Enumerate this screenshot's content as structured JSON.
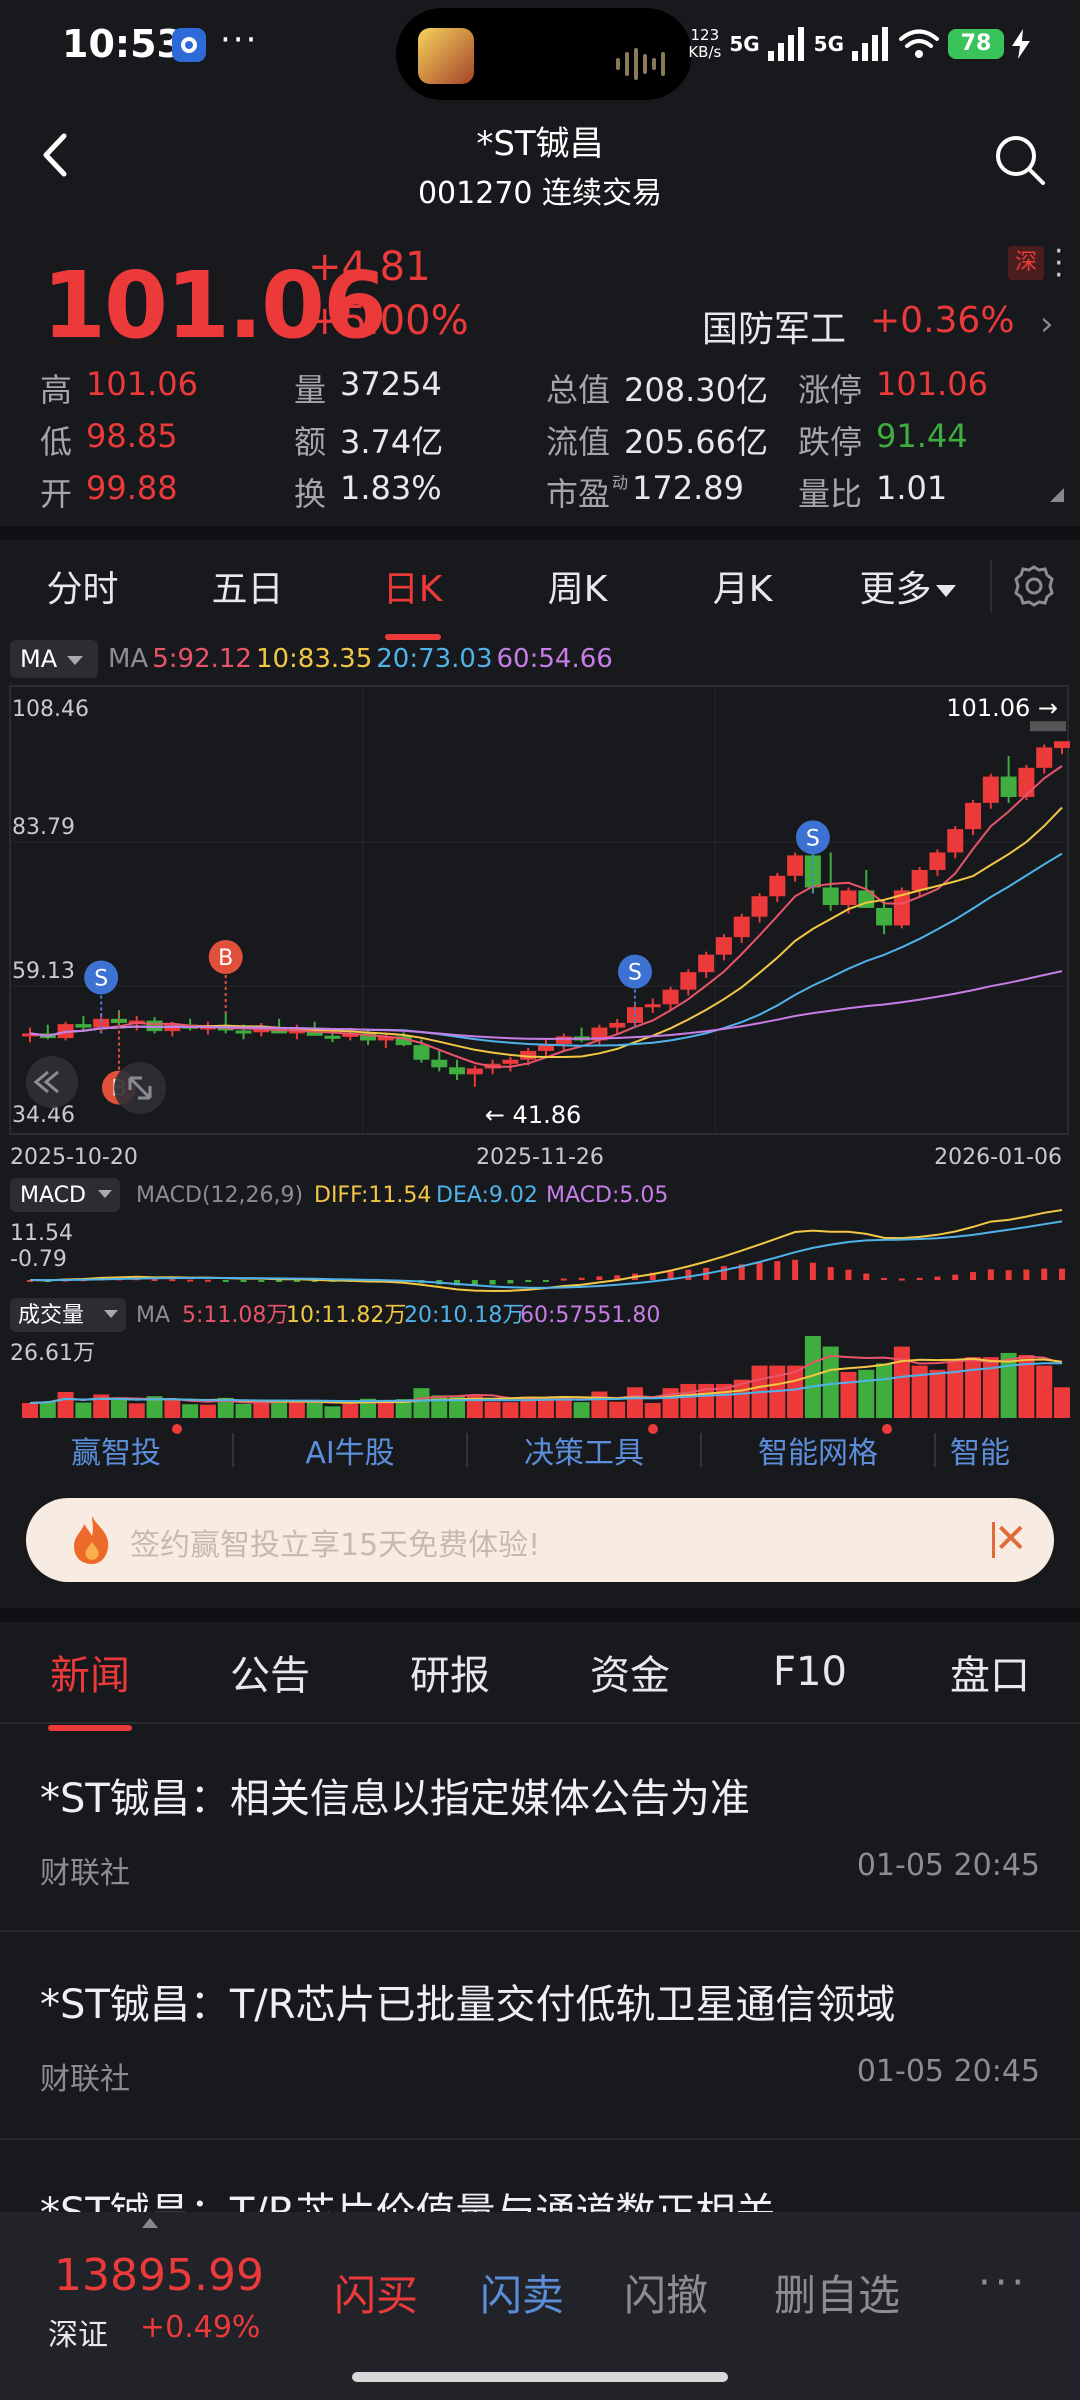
{
  "status_bar": {
    "time": "10:53",
    "dots": "···",
    "net_speed_top": "123",
    "net_speed_bottom": "KB/s",
    "sig1": "5G",
    "sig2": "5G",
    "battery": "78"
  },
  "header": {
    "title": "*ST铖昌",
    "subtitle": "001270 连续交易"
  },
  "quote": {
    "price": "101.06",
    "change": "+4.81",
    "change_pct": "+5.00%",
    "exchange_badge": "深",
    "sector_name": "国防军工",
    "sector_change": "+0.36%",
    "rows": [
      [
        {
          "label": "高",
          "value": "101.06",
          "color": "red"
        },
        {
          "label": "量",
          "value": "37254",
          "color": "white"
        },
        {
          "label": "总值",
          "value": "208.30亿",
          "color": "white"
        },
        {
          "label": "涨停",
          "value": "101.06",
          "color": "red"
        }
      ],
      [
        {
          "label": "低",
          "value": "98.85",
          "color": "red"
        },
        {
          "label": "额",
          "value": "3.74亿",
          "color": "white"
        },
        {
          "label": "流值",
          "value": "205.66亿",
          "color": "white"
        },
        {
          "label": "跌停",
          "value": "91.44",
          "color": "green"
        }
      ],
      [
        {
          "label": "开",
          "value": "99.88",
          "color": "red"
        },
        {
          "label": "换",
          "value": "1.83%",
          "color": "white"
        },
        {
          "label": "市盈",
          "sup": "动",
          "value": "172.89",
          "color": "white"
        },
        {
          "label": "量比",
          "value": "1.01",
          "color": "white"
        }
      ]
    ]
  },
  "period_tabs": [
    "分时",
    "五日",
    "日K",
    "周K",
    "月K",
    "更多"
  ],
  "active_period": "日K",
  "chart_data": {
    "type": "candlestick",
    "ma_chip": "MA",
    "ma_legend": [
      {
        "label": "MA",
        "color": "#8c8d93"
      },
      {
        "label": "5:92.12",
        "color": "#e8546a"
      },
      {
        "label": "10:83.35",
        "color": "#f2c744"
      },
      {
        "label": "20:73.03",
        "color": "#4fb3ea"
      },
      {
        "label": "60:54.66",
        "color": "#c77de6"
      }
    ],
    "y_ticks": [
      "108.46",
      "83.79",
      "59.13",
      "34.46"
    ],
    "y_values": [
      108.46,
      83.79,
      59.13,
      34.46
    ],
    "x_labels": [
      "2025-10-20",
      "2025-11-26",
      "2026-01-06"
    ],
    "last_price_label": "101.06 →",
    "low_label": "← 41.86",
    "markers": [
      {
        "text": "S",
        "type": "sell",
        "index": 4
      },
      {
        "text": "B",
        "type": "buy",
        "index": 11
      },
      {
        "text": "B",
        "type": "buy",
        "index": 5
      },
      {
        "text": "S",
        "type": "sell",
        "index": 34
      },
      {
        "text": "S",
        "type": "sell",
        "index": 44
      }
    ],
    "candles": [
      [
        50.5,
        52.0,
        49.5,
        51.0
      ],
      [
        51.0,
        52.5,
        50.0,
        50.2
      ],
      [
        50.2,
        53.0,
        49.8,
        52.6
      ],
      [
        52.6,
        54.0,
        51.5,
        52.0
      ],
      [
        52.0,
        54.5,
        51.0,
        53.5
      ],
      [
        53.5,
        55.0,
        52.0,
        52.8
      ],
      [
        52.8,
        54.0,
        51.5,
        53.2
      ],
      [
        53.2,
        53.8,
        51.0,
        51.4
      ],
      [
        51.4,
        53.0,
        50.5,
        52.5
      ],
      [
        52.5,
        53.5,
        51.5,
        51.8
      ],
      [
        51.8,
        53.0,
        50.8,
        52.2
      ],
      [
        52.2,
        54.5,
        51.0,
        51.5
      ],
      [
        51.5,
        52.5,
        50.0,
        51.2
      ],
      [
        51.2,
        52.8,
        50.5,
        52.0
      ],
      [
        52.0,
        53.5,
        51.0,
        51.0
      ],
      [
        51.0,
        52.5,
        50.0,
        51.8
      ],
      [
        51.8,
        53.0,
        50.8,
        50.6
      ],
      [
        50.6,
        51.5,
        49.5,
        50.4
      ],
      [
        50.4,
        52.0,
        49.8,
        51.0
      ],
      [
        51.0,
        51.8,
        49.0,
        49.8
      ],
      [
        49.8,
        51.0,
        48.5,
        50.5
      ],
      [
        50.5,
        51.2,
        48.8,
        49.0
      ],
      [
        49.0,
        50.0,
        46.0,
        46.5
      ],
      [
        46.5,
        48.0,
        44.5,
        45.2
      ],
      [
        45.2,
        46.5,
        43.0,
        44.0
      ],
      [
        44.0,
        45.5,
        41.86,
        45.0
      ],
      [
        45.0,
        46.5,
        44.0,
        45.8
      ],
      [
        45.8,
        47.0,
        44.5,
        46.5
      ],
      [
        46.5,
        48.5,
        45.5,
        48.0
      ],
      [
        48.0,
        50.0,
        47.0,
        49.2
      ],
      [
        49.2,
        51.0,
        48.0,
        50.5
      ],
      [
        50.5,
        52.0,
        49.5,
        49.8
      ],
      [
        49.8,
        52.5,
        49.0,
        52.0
      ],
      [
        52.0,
        53.5,
        51.0,
        52.8
      ],
      [
        52.8,
        56.0,
        52.0,
        55.5
      ],
      [
        55.5,
        57.0,
        54.5,
        56.0
      ],
      [
        56.0,
        59.0,
        55.0,
        58.5
      ],
      [
        58.5,
        62.0,
        57.5,
        61.5
      ],
      [
        61.5,
        65.0,
        60.5,
        64.5
      ],
      [
        64.5,
        68.0,
        63.5,
        67.5
      ],
      [
        67.5,
        71.5,
        66.5,
        71.0
      ],
      [
        71.0,
        75.0,
        70.0,
        74.5
      ],
      [
        74.5,
        78.5,
        73.5,
        78.0
      ],
      [
        78.0,
        82.0,
        77.0,
        81.5
      ],
      [
        81.5,
        85.0,
        75.0,
        76.0
      ],
      [
        76.0,
        82.0,
        72.0,
        73.0
      ],
      [
        73.0,
        76.0,
        71.5,
        75.5
      ],
      [
        75.5,
        79.0,
        74.5,
        72.5
      ],
      [
        72.5,
        74.0,
        68.0,
        69.5
      ],
      [
        69.5,
        76.0,
        69.0,
        75.5
      ],
      [
        75.5,
        79.5,
        74.5,
        79.0
      ],
      [
        79.0,
        82.5,
        78.0,
        82.0
      ],
      [
        82.0,
        86.5,
        81.0,
        86.0
      ],
      [
        86.0,
        91.0,
        85.0,
        90.5
      ],
      [
        90.5,
        95.5,
        89.5,
        95.0
      ],
      [
        95.0,
        98.5,
        90.5,
        91.5
      ],
      [
        91.5,
        97.0,
        91.0,
        96.5
      ],
      [
        96.5,
        100.5,
        95.5,
        100.0
      ],
      [
        99.88,
        101.06,
        98.85,
        101.06
      ]
    ],
    "macd": {
      "chip": "MACD",
      "label": "MACD(12,26,9)",
      "diff_label": "DIFF:11.54",
      "dea_label": "DEA:9.02",
      "macd_label": "MACD:5.05",
      "y_ticks": [
        "11.54",
        "-0.79"
      ]
    },
    "volume": {
      "chip": "成交量",
      "ma_label": "MA",
      "legend": [
        {
          "label": "5:11.08万",
          "color": "#e8546a"
        },
        {
          "label": "10:11.82万",
          "color": "#f2c744"
        },
        {
          "label": "20:10.18万",
          "color": "#4fb3ea"
        },
        {
          "label": "60:57551.80",
          "color": "#c77de6"
        }
      ],
      "y_tick": "26.61万"
    }
  },
  "feature_nav": [
    {
      "label": "赢智投",
      "dot": true
    },
    {
      "label": "AI牛股",
      "dot": false
    },
    {
      "label": "决策工具",
      "dot": true
    },
    {
      "label": "智能网格",
      "dot": true
    },
    {
      "label": "智能",
      "dot": false
    }
  ],
  "promo": {
    "text": "签约赢智投立享15天免费体验!"
  },
  "news_tabs": [
    "新闻",
    "公告",
    "研报",
    "资金",
    "F10",
    "盘口"
  ],
  "active_news_tab": "新闻",
  "news": [
    {
      "title": "*ST铖昌：相关信息以指定媒体公告为准",
      "source": "财联社",
      "time": "01-05 20:45"
    },
    {
      "title": "*ST铖昌：T/R芯片已批量交付低轨卫星通信领域",
      "source": "财联社",
      "time": "01-05 20:45"
    },
    {
      "title": "*ST铖昌：T/R芯片价值量与通道数正相关",
      "source": "",
      "time": ""
    }
  ],
  "bottom_bar": {
    "index_value": "13895.99",
    "index_name": "深证",
    "index_change": "+0.49%",
    "buttons": [
      "闪买",
      "闪卖",
      "闪撤",
      "删自选"
    ],
    "more": "···"
  },
  "colors": {
    "up": "#ec3a3a",
    "down": "#3fae3f",
    "accent_blue": "#5b8dd9",
    "bg": "#18191d"
  }
}
